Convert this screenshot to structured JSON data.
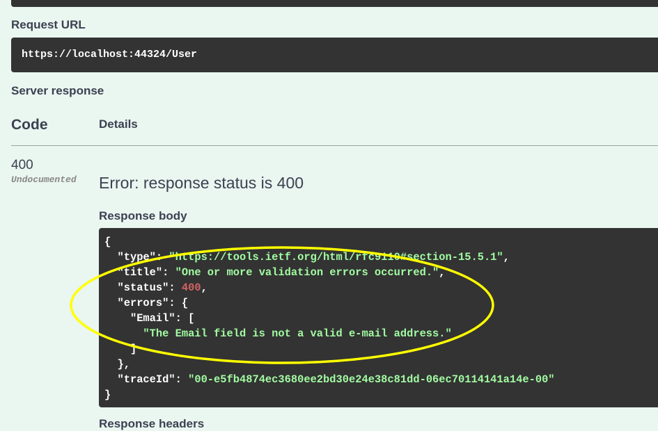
{
  "request_url": {
    "label": "Request URL",
    "value": "https://localhost:44324/User"
  },
  "server_response": {
    "label": "Server response",
    "code_header": "Code",
    "details_header": "Details",
    "code": "400",
    "code_note": "Undocumented",
    "error_message": "Error: response status is 400",
    "response_body_label": "Response body",
    "response_body": {
      "open_brace": "{",
      "type_key": "\"type\"",
      "type_value": "\"https://tools.ietf.org/html/rfc9110#section-15.5.1\"",
      "title_key": "\"title\"",
      "title_value": "\"One or more validation errors occurred.\"",
      "status_key": "\"status\"",
      "status_value": "400",
      "errors_key": "\"errors\"",
      "email_key": "\"Email\"",
      "email_error": "\"The Email field is not a valid e-mail address.\"",
      "traceid_key": "\"traceId\"",
      "traceid_value": "\"00-e5fb4874ec3680ee2bd30e24e38c81dd-06ec70114141a14e-00\"",
      "close_brace": "}"
    },
    "response_headers_label": "Response headers"
  },
  "annotation_color": "#ffff00"
}
